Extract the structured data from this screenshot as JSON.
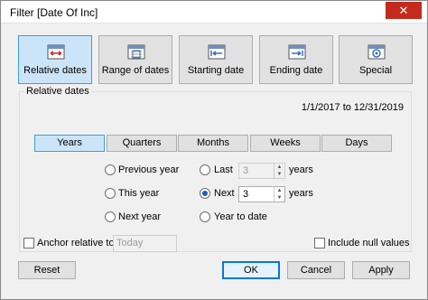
{
  "window": {
    "title": "Filter [Date Of Inc]",
    "close_glyph": "✕"
  },
  "modes": [
    {
      "label": "Relative dates",
      "icon": "relative-dates-icon",
      "active": true
    },
    {
      "label": "Range of dates",
      "icon": "range-of-dates-icon",
      "active": false
    },
    {
      "label": "Starting date",
      "icon": "starting-date-icon",
      "active": false
    },
    {
      "label": "Ending date",
      "icon": "ending-date-icon",
      "active": false
    },
    {
      "label": "Special",
      "icon": "special-icon",
      "active": false
    }
  ],
  "relative": {
    "group_label": "Relative dates",
    "range_text": "1/1/2017 to 12/31/2019",
    "units": [
      "Years",
      "Quarters",
      "Months",
      "Weeks",
      "Days"
    ],
    "selected_unit": "Years",
    "options": {
      "previous": "Previous year",
      "this": "This year",
      "next_year": "Next year",
      "last": "Last",
      "next": "Next",
      "to_date": "Year to date",
      "suffix": "years"
    },
    "selected_option": "Next",
    "last_value": "3",
    "next_value": "3"
  },
  "anchor": {
    "label": "Anchor relative to",
    "value": "Today",
    "checked": false
  },
  "include_null": {
    "label": "Include null values",
    "checked": false
  },
  "buttons": {
    "reset": "Reset",
    "ok": "OK",
    "cancel": "Cancel",
    "apply": "Apply"
  },
  "colors": {
    "accent": "#3c9de3",
    "active_bg": "#cce4f7",
    "close_bg": "#c42b1c"
  }
}
